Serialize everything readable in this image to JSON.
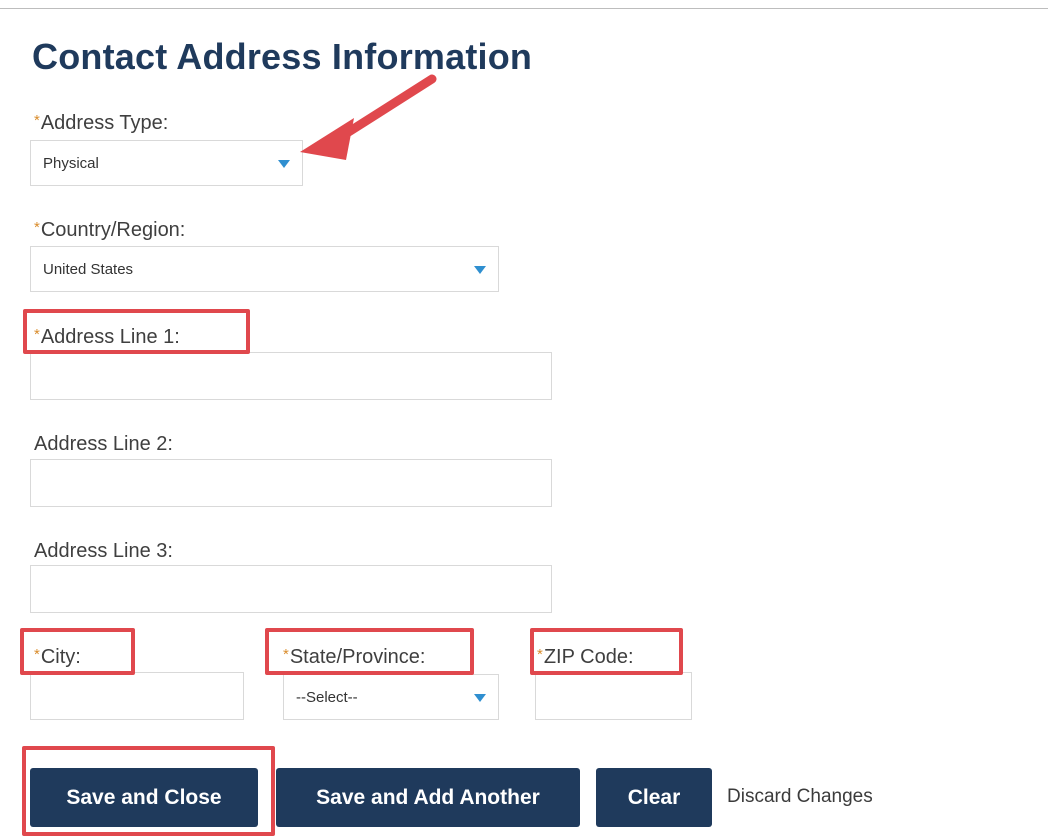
{
  "form": {
    "title": "Contact Address Information",
    "required_mark": "*",
    "address_type": {
      "label": "Address Type:",
      "value": "Physical"
    },
    "country": {
      "label": "Country/Region:",
      "value": "United States"
    },
    "address_line_1": {
      "label": "Address Line 1:",
      "value": ""
    },
    "address_line_2": {
      "label": "Address Line 2:",
      "value": ""
    },
    "address_line_3": {
      "label": "Address Line 3:",
      "value": ""
    },
    "city": {
      "label": "City:",
      "value": ""
    },
    "state": {
      "label": "State/Province:",
      "value": "--Select--"
    },
    "zip": {
      "label": "ZIP Code:",
      "value": ""
    }
  },
  "buttons": {
    "save_close": "Save and Close",
    "save_add": "Save and Add Another",
    "clear": "Clear",
    "discard": "Discard Changes"
  },
  "colors": {
    "button_bg": "#1f3a5c",
    "title": "#1f3a5c",
    "required": "#d98c2b",
    "annotation": "#e0484d",
    "caret": "#2f8fd0"
  }
}
